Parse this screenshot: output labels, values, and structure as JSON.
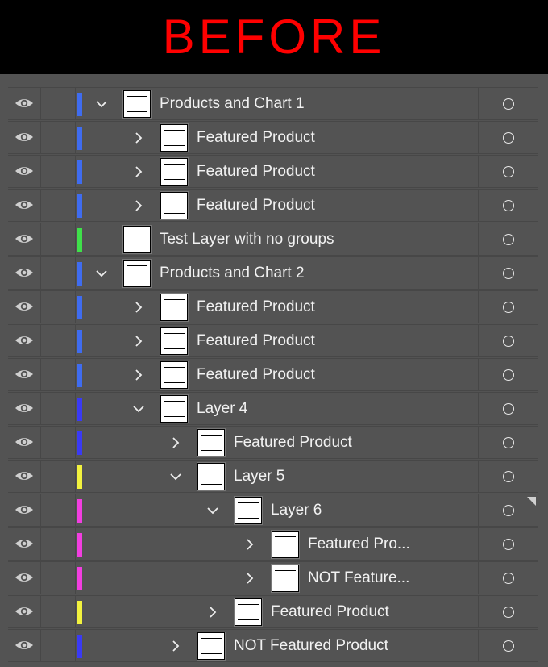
{
  "banner": {
    "text": "BEFORE",
    "color": "#ff0000"
  },
  "icons": {
    "visibility": "eye-icon",
    "expanded": "chevron-down-icon",
    "collapsed": "chevron-right-icon",
    "target": "target-circle-icon"
  },
  "colors": {
    "blue": "#3f6cf0",
    "green": "#3fe04a",
    "indigo": "#3a3af5",
    "yellow": "#f2f23e",
    "magenta": "#f23ee0"
  },
  "layers": [
    {
      "name": "Products and Chart 1",
      "depth": 0,
      "state": "expanded",
      "color": "blue",
      "thumb": "lines"
    },
    {
      "name": "Featured Product",
      "depth": 1,
      "state": "collapsed",
      "color": "blue",
      "thumb": "lines"
    },
    {
      "name": "Featured Product",
      "depth": 1,
      "state": "collapsed",
      "color": "blue",
      "thumb": "lines"
    },
    {
      "name": "Featured Product",
      "depth": 1,
      "state": "collapsed",
      "color": "blue",
      "thumb": "lines"
    },
    {
      "name": "Test Layer with no groups",
      "depth": 0,
      "state": "none",
      "color": "green",
      "thumb": "blank"
    },
    {
      "name": "Products and Chart 2",
      "depth": 0,
      "state": "expanded",
      "color": "blue",
      "thumb": "lines"
    },
    {
      "name": "Featured Product",
      "depth": 1,
      "state": "collapsed",
      "color": "blue",
      "thumb": "lines"
    },
    {
      "name": "Featured Product",
      "depth": 1,
      "state": "collapsed",
      "color": "blue",
      "thumb": "lines"
    },
    {
      "name": "Featured Product",
      "depth": 1,
      "state": "collapsed",
      "color": "blue",
      "thumb": "lines"
    },
    {
      "name": "Layer 4",
      "depth": 1,
      "state": "expanded",
      "color": "indigo",
      "thumb": "lines"
    },
    {
      "name": "Featured Product",
      "depth": 2,
      "state": "collapsed",
      "color": "indigo",
      "thumb": "lines"
    },
    {
      "name": "Layer 5",
      "depth": 2,
      "state": "expanded",
      "color": "yellow",
      "thumb": "lines"
    },
    {
      "name": "Layer 6",
      "depth": 3,
      "state": "expanded",
      "color": "magenta",
      "thumb": "lines"
    },
    {
      "name": "Featured Pro...",
      "depth": 4,
      "state": "collapsed",
      "color": "magenta",
      "thumb": "lines"
    },
    {
      "name": "NOT Feature...",
      "depth": 4,
      "state": "collapsed",
      "color": "magenta",
      "thumb": "lines"
    },
    {
      "name": "Featured Product",
      "depth": 3,
      "state": "collapsed",
      "color": "yellow",
      "thumb": "lines"
    },
    {
      "name": "NOT Featured Product",
      "depth": 2,
      "state": "collapsed",
      "color": "indigo",
      "thumb": "lines"
    }
  ]
}
